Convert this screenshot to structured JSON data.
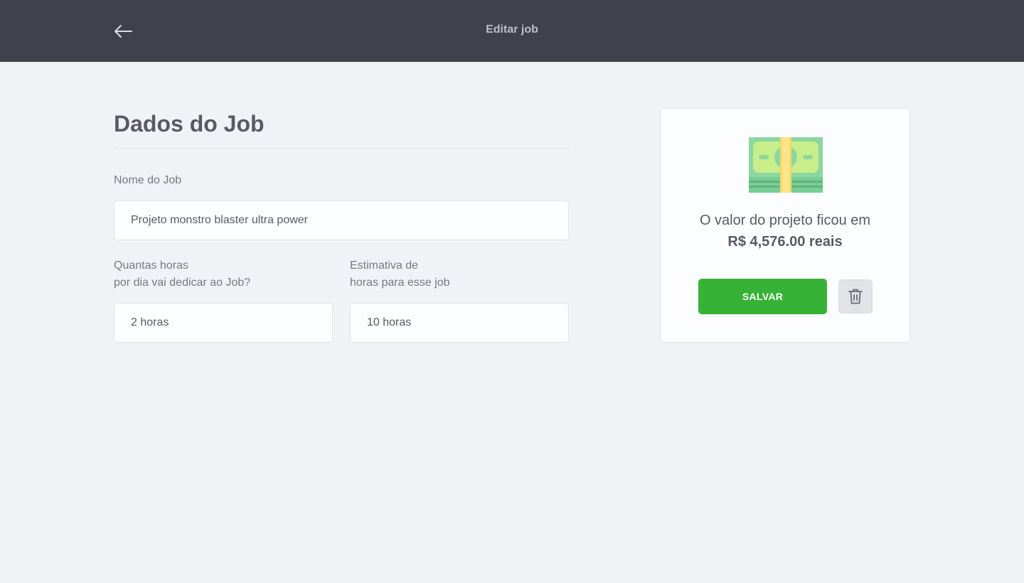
{
  "header": {
    "title": "Editar job",
    "back_icon": "arrow-left-icon"
  },
  "form": {
    "section_title": "Dados do Job",
    "name_label": "Nome do Job",
    "name_value": "Projeto monstro blaster ultra power",
    "hours_label_line1": "Quantas horas",
    "hours_label_line2": "por dia vai dedicar ao Job?",
    "hours_value": "2 horas",
    "estimate_label_line1": "Estimativa de",
    "estimate_label_line2": "horas para esse job",
    "estimate_value": "10 horas"
  },
  "summary": {
    "icon": "money-icon",
    "text": "O valor do projeto ficou em",
    "value": "R$ 4,576.00 reais",
    "save_label": "SALVAR",
    "delete_icon": "trash-icon"
  },
  "colors": {
    "header_bg": "#41414D",
    "page_bg": "#F1F2F6",
    "accent_green": "#36B336",
    "text_primary": "#5A5A66",
    "text_label": "#787880"
  }
}
